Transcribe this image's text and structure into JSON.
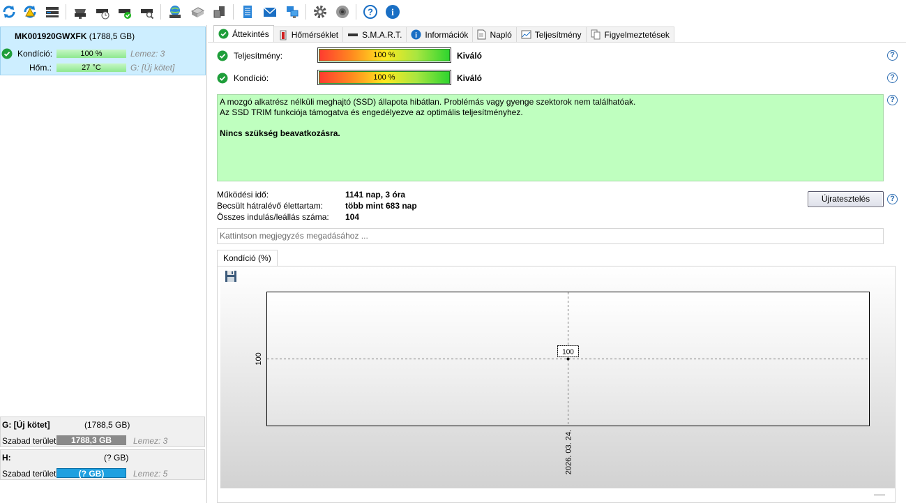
{
  "toolbar": {
    "icons": [
      "refresh-icon",
      "refresh-warning-icon",
      "drive-list-icon",
      "drive-icon",
      "drive-clock-icon",
      "drive-check-icon",
      "drive-search-icon",
      "globe-drive-icon",
      "usb-drive-icon",
      "external-drive-icon",
      "notepad-icon",
      "mail-icon",
      "network-icon",
      "gear-icon",
      "speaker-icon",
      "help-icon",
      "info-icon"
    ]
  },
  "disk": {
    "model": "MK001920GWXFK",
    "size": "(1788,5 GB)",
    "condition_label": "Kondíció:",
    "condition_value": "100 %",
    "condition_percent": 100,
    "disk_index": "Lemez: 3",
    "temp_label": "Hőm.:",
    "temp_value": "27 °C",
    "volume": "G: [Új kötet]"
  },
  "volumes": [
    {
      "name": "G: [Új kötet]",
      "size": "(1788,5 GB)",
      "free_label": "Szabad terület",
      "free_value": "1788,3 GB",
      "disk": "Lemez: 3",
      "bar_color": "#8a8a8a"
    },
    {
      "name": "H:",
      "size": "(? GB)",
      "free_label": "Szabad terület",
      "free_value": "(? GB)",
      "disk": "Lemez: 5",
      "bar_color": "#1ea0e0"
    }
  ],
  "tabs": [
    {
      "label": "Áttekintés",
      "icon": "check-circle-icon",
      "active": true
    },
    {
      "label": "Hőmérséklet",
      "icon": "thermometer-icon"
    },
    {
      "label": "S.M.A.R.T.",
      "icon": "drive-icon"
    },
    {
      "label": "Információk",
      "icon": "info-icon"
    },
    {
      "label": "Napló",
      "icon": "document-icon"
    },
    {
      "label": "Teljesítmény",
      "icon": "chart-icon"
    },
    {
      "label": "Figyelmeztetések",
      "icon": "pages-icon"
    }
  ],
  "overview": {
    "performance_label": "Teljesítmény:",
    "performance_value": "100 %",
    "performance_percent": 100,
    "performance_rating": "Kiváló",
    "condition_label": "Kondíció:",
    "condition_value": "100 %",
    "condition_percent": 100,
    "condition_rating": "Kiváló",
    "status_line1": "A mozgó alkatrész nélküli meghajtó (SSD) állapota hibátlan. Problémás vagy gyenge szektorok nem találhatóak.",
    "status_line2": "Az SSD TRIM funkciója támogatva és engedélyezve az optimális teljesítményhez.",
    "status_action": "Nincs szükség beavatkozásra.",
    "uptime_label": "Működési idő:",
    "uptime_value": "1141 nap, 3 óra",
    "lifetime_label": "Becsült hátralévő élettartam:",
    "lifetime_value": "több mint 683 nap",
    "startstop_label": "Összes indulás/leállás száma:",
    "startstop_value": "104",
    "retest_button": "Újratesztelés",
    "note_placeholder": "Kattintson megjegyzés megadásához ..."
  },
  "chart_tab": "Kondíció  (%)",
  "chart_data": {
    "type": "line",
    "title": "",
    "x": [
      "2026. 03. 24."
    ],
    "series": [
      {
        "values": [
          100
        ]
      }
    ],
    "ytick": "100",
    "data_label": "100",
    "xtick": "2026. 03. 24.",
    "grid": true
  }
}
